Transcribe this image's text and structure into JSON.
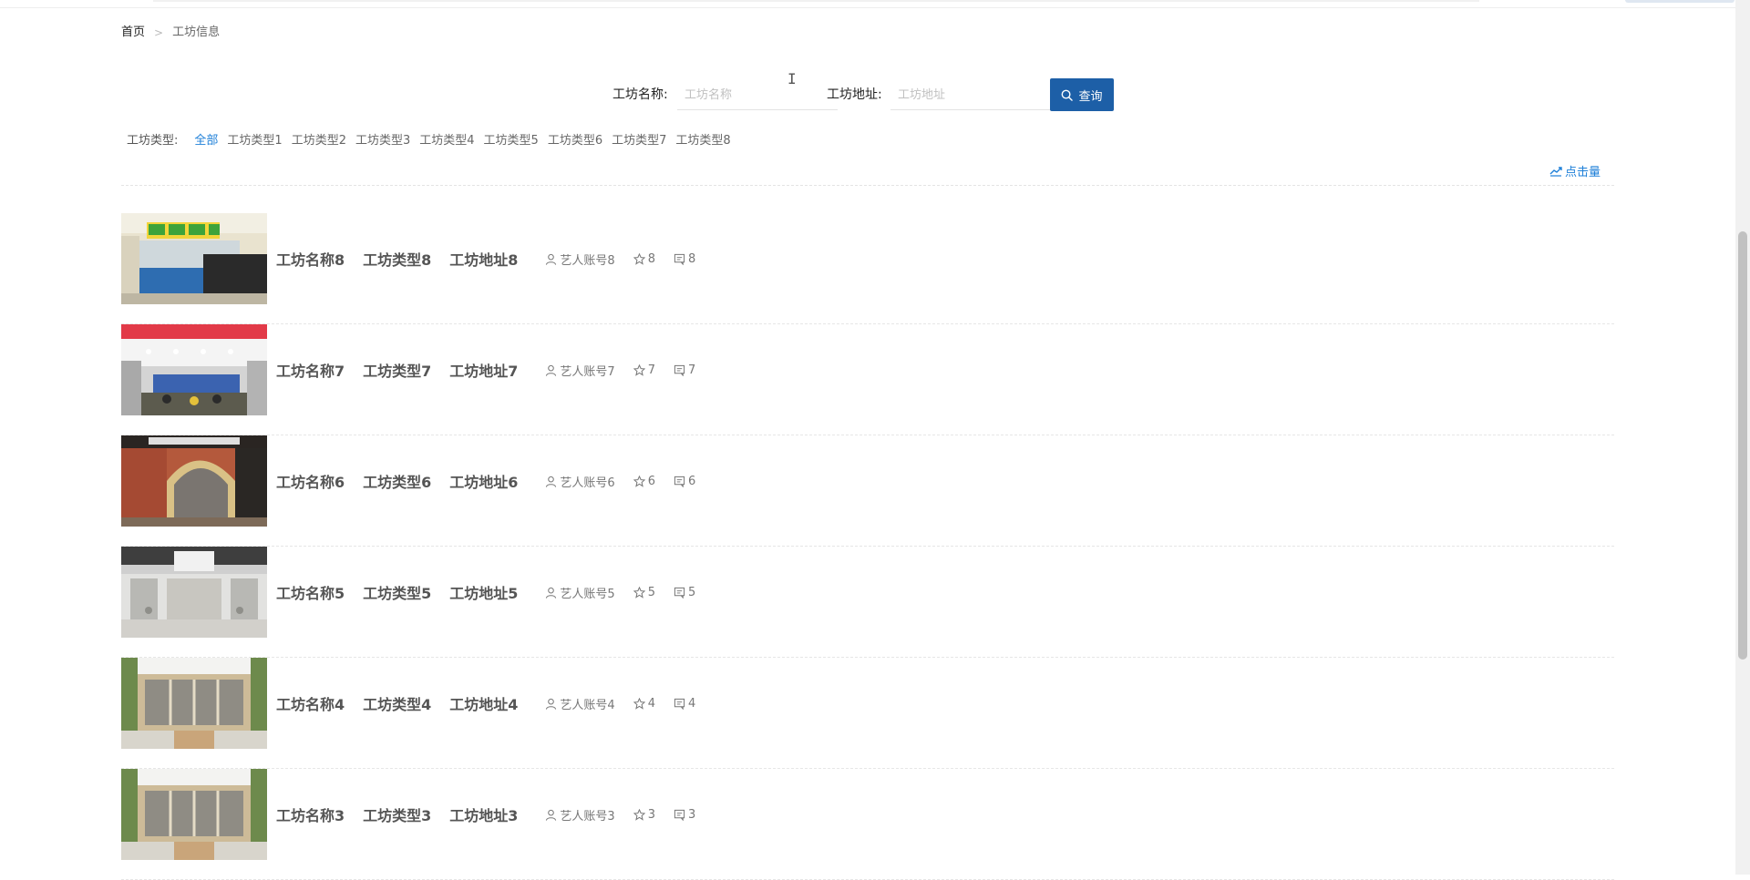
{
  "breadcrumb": {
    "home": "首页",
    "separator": ">",
    "current": "工坊信息"
  },
  "search": {
    "name_label": "工坊名称:",
    "name_placeholder": "工坊名称",
    "name_value": "",
    "address_label": "工坊地址:",
    "address_placeholder": "工坊地址",
    "address_value": "",
    "button_label": "查询"
  },
  "filters": {
    "label": "工坊类型:",
    "selected": "全部",
    "items": [
      "全部",
      "工坊类型1",
      "工坊类型2",
      "工坊类型3",
      "工坊类型4",
      "工坊类型5",
      "工坊类型6",
      "工坊类型7",
      "工坊类型8"
    ]
  },
  "sort": {
    "label": "点击量",
    "icon": "trend-chart-icon"
  },
  "workshops": [
    {
      "name": "工坊名称8",
      "type": "工坊类型8",
      "address": "工坊地址8",
      "artist": "艺人账号8",
      "favorites": "8",
      "comments": "8"
    },
    {
      "name": "工坊名称7",
      "type": "工坊类型7",
      "address": "工坊地址7",
      "artist": "艺人账号7",
      "favorites": "7",
      "comments": "7"
    },
    {
      "name": "工坊名称6",
      "type": "工坊类型6",
      "address": "工坊地址6",
      "artist": "艺人账号6",
      "favorites": "6",
      "comments": "6"
    },
    {
      "name": "工坊名称5",
      "type": "工坊类型5",
      "address": "工坊地址5",
      "artist": "艺人账号5",
      "favorites": "5",
      "comments": "5"
    },
    {
      "name": "工坊名称4",
      "type": "工坊类型4",
      "address": "工坊地址4",
      "artist": "艺人账号4",
      "favorites": "4",
      "comments": "4"
    },
    {
      "name": "工坊名称3",
      "type": "工坊类型3",
      "address": "工坊地址3",
      "artist": "艺人账号3",
      "favorites": "3",
      "comments": "3"
    }
  ],
  "colors": {
    "accent": "#1d5fa7",
    "link": "#1d7fd8",
    "muted": "#777777"
  }
}
